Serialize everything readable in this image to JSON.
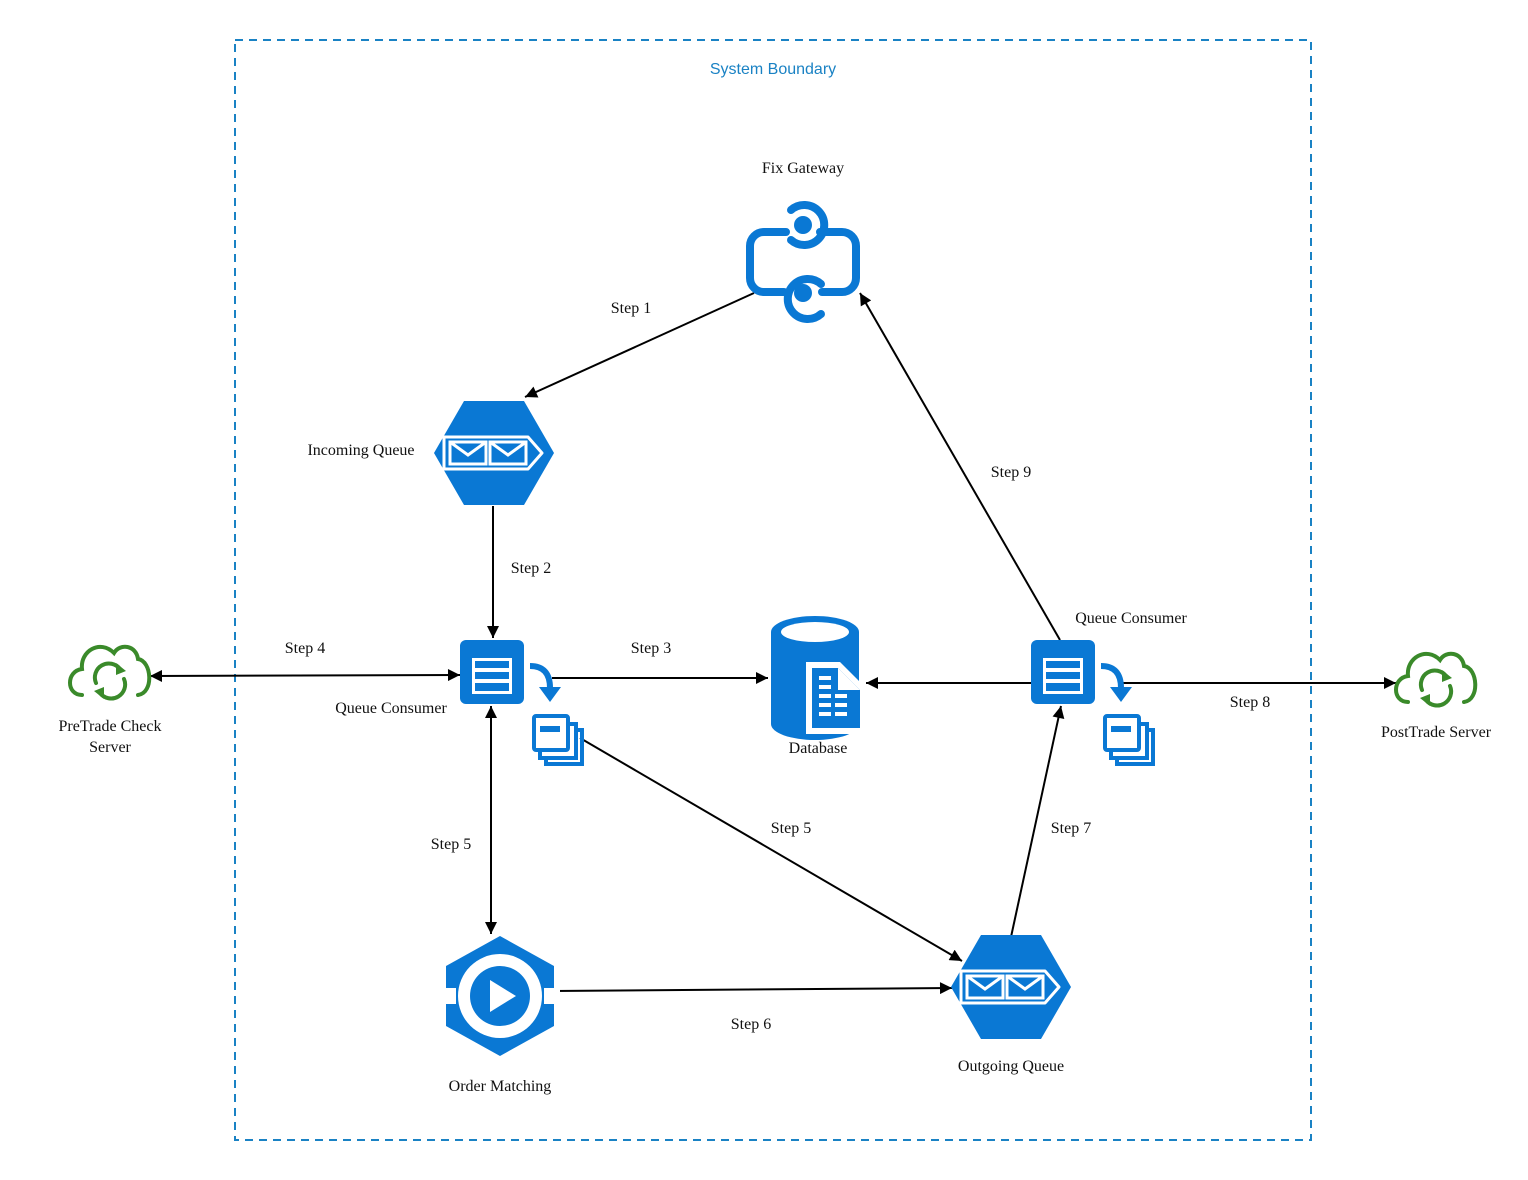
{
  "diagram": {
    "boundary": {
      "label": "System Boundary",
      "color": "#1a82c4"
    },
    "colors": {
      "azure": "#0a78d4",
      "green": "#3a8a2a",
      "line": "#000000"
    },
    "nodes": {
      "fix_gateway": {
        "label": "Fix Gateway",
        "icon": "api-gateway-icon"
      },
      "incoming_queue": {
        "label": "Incoming Queue",
        "icon": "queue-hexagon-icon"
      },
      "queue_consumer_left": {
        "label": "Queue Consumer",
        "icon": "queue-consumer-icon"
      },
      "database": {
        "label": "Database",
        "icon": "database-icon"
      },
      "queue_consumer_right": {
        "label": "Queue Consumer",
        "icon": "queue-consumer-icon"
      },
      "order_matching": {
        "label": "Order Matching",
        "icon": "stream-play-icon"
      },
      "outgoing_queue": {
        "label": "Outgoing Queue",
        "icon": "queue-hexagon-icon"
      },
      "pretrade": {
        "label_line1": "PreTrade Check",
        "label_line2": "Server",
        "icon": "cloud-sync-icon"
      },
      "posttrade": {
        "label": "PostTrade Server",
        "icon": "cloud-sync-icon"
      }
    },
    "edges": [
      {
        "id": "step1",
        "label": "Step 1",
        "from": "Fix Gateway",
        "to": "Incoming Queue"
      },
      {
        "id": "step2",
        "label": "Step 2",
        "from": "Incoming Queue",
        "to": "Queue Consumer"
      },
      {
        "id": "step3",
        "label": "Step 3",
        "from": "Queue Consumer",
        "to": "Database"
      },
      {
        "id": "step4",
        "label": "Step 4",
        "from": "Queue Consumer",
        "to": "PreTrade Check Server",
        "bidirectional": true
      },
      {
        "id": "step5a",
        "label": "Step 5",
        "from": "Queue Consumer",
        "to": "Order Matching",
        "bidirectional": true
      },
      {
        "id": "step5b",
        "label": "Step 5",
        "from": "Queue Consumer",
        "to": "Outgoing Queue"
      },
      {
        "id": "step6",
        "label": "Step 6",
        "from": "Order Matching",
        "to": "Outgoing Queue"
      },
      {
        "id": "step7",
        "label": "Step 7",
        "from": "Outgoing Queue",
        "to": "Queue Consumer"
      },
      {
        "id": "step8",
        "label": "Step 8",
        "from": "Queue Consumer",
        "to": "PostTrade Server"
      },
      {
        "id": "step9",
        "label": "Step 9",
        "from": "Queue Consumer",
        "to": "Fix Gateway"
      },
      {
        "id": "db_write",
        "label": "",
        "from": "Queue Consumer",
        "to": "Database"
      }
    ]
  }
}
